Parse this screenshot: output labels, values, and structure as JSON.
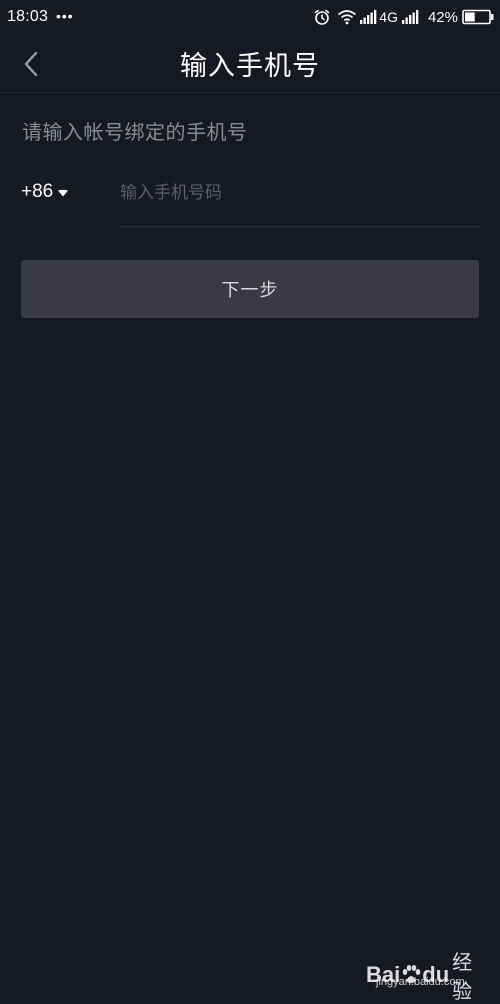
{
  "status_bar": {
    "time": "18:03",
    "dots": "•••",
    "network": "4G",
    "battery": "42%",
    "battery_level": 0.42,
    "icons": [
      "alarm-icon",
      "wifi-icon",
      "signal-icon",
      "signal-icon",
      "battery-icon"
    ]
  },
  "header": {
    "back_icon": "chevron-left-icon",
    "title": "输入手机号"
  },
  "form": {
    "subtitle": "请输入帐号绑定的手机号",
    "country_code": "+86",
    "country_code_icon": "caret-down-icon",
    "phone_placeholder": "输入手机号码",
    "phone_value": "",
    "next_label": "下一步"
  },
  "watermark": {
    "logo_text_1": "Bai",
    "logo_text_2": "du",
    "logo_text_3": "经验",
    "url": "jingyan.baidu.com"
  },
  "colors": {
    "background": "#161823",
    "button": "#3a3a45",
    "subtitle": "#8a8b91",
    "placeholder": "#5d5f68"
  }
}
